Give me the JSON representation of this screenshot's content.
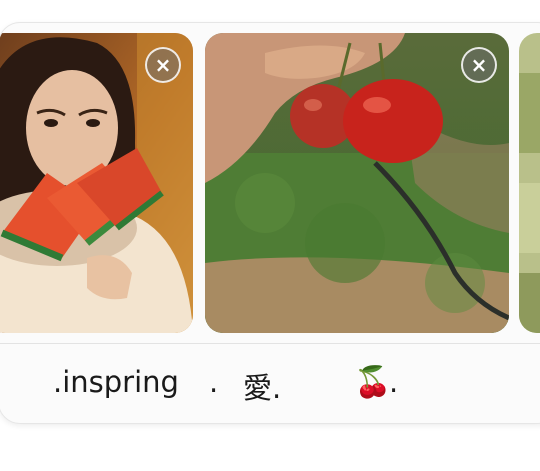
{
  "gallery": {
    "images": [
      {
        "subject": "woman eating watermelon",
        "close_icon": "×"
      },
      {
        "subject": "hand holding cherries over grass",
        "close_icon": "×"
      },
      {
        "subject": "partial image cut off at edge"
      }
    ]
  },
  "caption": {
    "part1": ".inspring",
    "part2": ".",
    "part3": "愛.",
    "part4": "🍒",
    "part5": "."
  },
  "colors": {
    "card_border": "#e6e6e6",
    "close_button_bg": "#6e6e6e",
    "text": "#1a1a1a"
  }
}
